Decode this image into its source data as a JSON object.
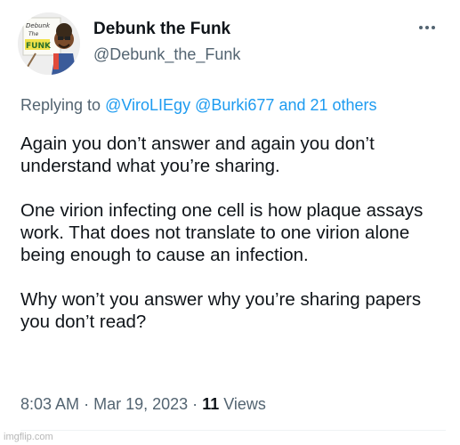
{
  "tweet": {
    "author": {
      "display_name": "Debunk the Funk",
      "handle": "@Debunk_the_Funk",
      "avatar_sign_lines": [
        "Debunk",
        "The",
        "FUNK"
      ]
    },
    "more_icon": "more-horizontal-icon",
    "reply_to": {
      "prefix": "Replying to",
      "user1": "@ViroLIEgy",
      "user2": "@Burki677",
      "others": "and 21 others"
    },
    "paragraphs": [
      "Again you don’t answer and again you don’t understand what you’re sharing.",
      "One virion infecting one cell is how plaque assays work. That does not translate to one virion alone being enough to cause an infection.",
      "Why won’t you answer why you’re sharing papers you don’t read?"
    ],
    "meta": {
      "time": "8:03 AM",
      "separator": "·",
      "date": "Mar 19, 2023",
      "views_count": "11",
      "views_label": "Views"
    }
  },
  "watermark": "imgflip.com",
  "colors": {
    "link": "#1d9bf0",
    "secondary_text": "#536471",
    "primary_text": "#0f1419"
  }
}
